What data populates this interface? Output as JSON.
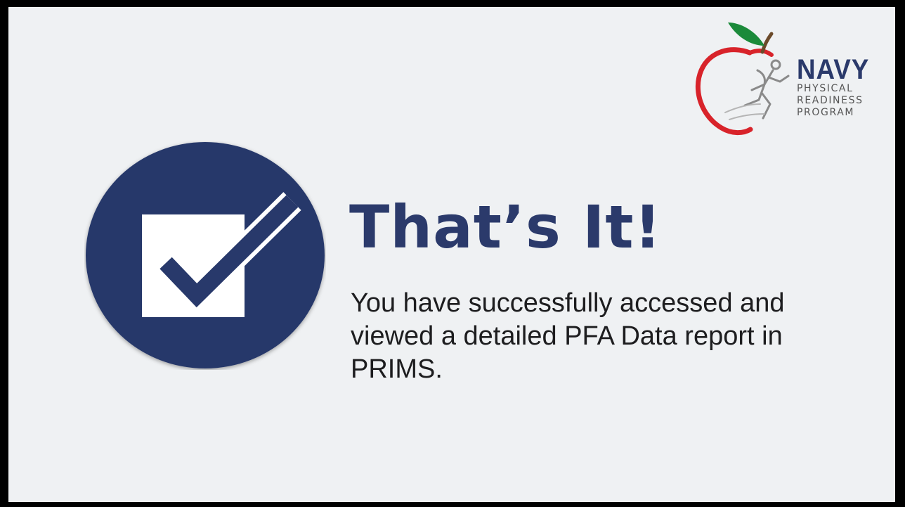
{
  "branding": {
    "logo_word": "NAVY",
    "logo_lines": [
      "PHYSICAL",
      "READINESS",
      "PROGRAM"
    ],
    "logo_icon": "apple-runner-icon",
    "primary_color": "#2b3a6b",
    "apple_red": "#d8232a",
    "leaf_green": "#1b8a3a"
  },
  "completion": {
    "icon": "checkbox-checked-icon",
    "title": "That’s It!",
    "message": "You have successfully accessed and viewed a detailed PFA Data report in PRIMS."
  }
}
